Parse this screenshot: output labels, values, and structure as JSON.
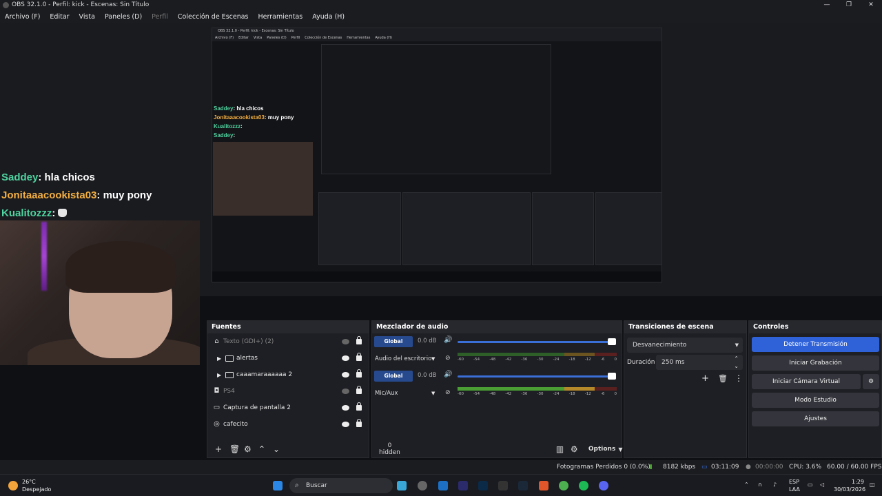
{
  "window": {
    "title": "OBS 32.1.0 - Perfil: kick - Escenas: Sin Título",
    "controls": [
      "—",
      "❐",
      "✕"
    ]
  },
  "menu": {
    "items": [
      "Archivo (F)",
      "Editar",
      "Vista",
      "Paneles (D)",
      "Perfil",
      "Colección de Escenas",
      "Herramientas",
      "Ayuda (H)"
    ]
  },
  "chat": [
    {
      "user": "Saddey",
      "message": ": hla chicos",
      "color": "#4fd3a0"
    },
    {
      "user": "Jonitaaacookista03",
      "message": ": muy pony",
      "color": "#f5b041"
    },
    {
      "user": "Kualitozzz",
      "message": ":",
      "color": "#4fd3a0"
    },
    {
      "user": "Saddey",
      "message": ":",
      "color": "#4fd3a0"
    }
  ],
  "nested": {
    "title": "OBS 32.1.0 - Perfil: kick - Escenas: Sin Título",
    "menu": [
      "Archivo (F)",
      "Editar",
      "Vista",
      "Paneles (D)",
      "Perfil",
      "Colección de Escenas",
      "Herramientas",
      "Ayuda (H)"
    ]
  },
  "sources": {
    "header": "Fuentes",
    "items": [
      {
        "label": "Texto (GDI+) (2)",
        "icon": "text-icon",
        "visible": false,
        "group": false
      },
      {
        "label": "alertas",
        "icon": "folder-icon",
        "visible": true,
        "group": true
      },
      {
        "label": "caaamaraaaaaa 2",
        "icon": "folder-icon",
        "visible": true,
        "group": true
      },
      {
        "label": "PS4",
        "icon": "camera-icon",
        "visible": false,
        "group": false
      },
      {
        "label": "Captura de pantalla 2",
        "icon": "monitor-icon",
        "visible": true,
        "group": false
      },
      {
        "label": "cafecito",
        "icon": "globe-icon",
        "visible": true,
        "group": false
      }
    ]
  },
  "mixer": {
    "header": "Mezclador de audio",
    "channels": [
      {
        "badge": "Global",
        "db": "0.0 dB",
        "device": "Audio del escritorio",
        "level": 1.0
      },
      {
        "badge": "Global",
        "db": "0.0 dB",
        "device": "Mic/Aux",
        "level": 1.0
      }
    ],
    "ticks": [
      "-60",
      "-54",
      "-48",
      "-42",
      "-36",
      "-30",
      "-24",
      "-18",
      "-12",
      "-6",
      "0"
    ],
    "hidden_label": "0 hidden",
    "options_label": "Options"
  },
  "transitions": {
    "header": "Transiciones de escena",
    "selected": "Desvanecimiento",
    "duration_label": "Duración",
    "duration_value": "250 ms"
  },
  "controls": {
    "header": "Controles",
    "buttons": [
      "Detener Transmisión",
      "Iniciar Grabación",
      "Iniciar Cámara Virtual",
      "Modo Estudio",
      "Ajustes"
    ]
  },
  "status": {
    "dropped": "Fotogramas Perdidos 0 (0.0%)",
    "bitrate": "8182 kbps",
    "stream_time": "03:11:09",
    "rec_time": "00:00:00",
    "cpu": "CPU: 3.6%",
    "fps": "60.00 / 60.00 FPS"
  },
  "taskbar": {
    "weather_temp": "26°C",
    "weather_desc": "Despejado",
    "search_placeholder": "Buscar",
    "lang": "ESP",
    "lang2": "LAA",
    "time": "1:29",
    "date": "30/03/2026"
  }
}
